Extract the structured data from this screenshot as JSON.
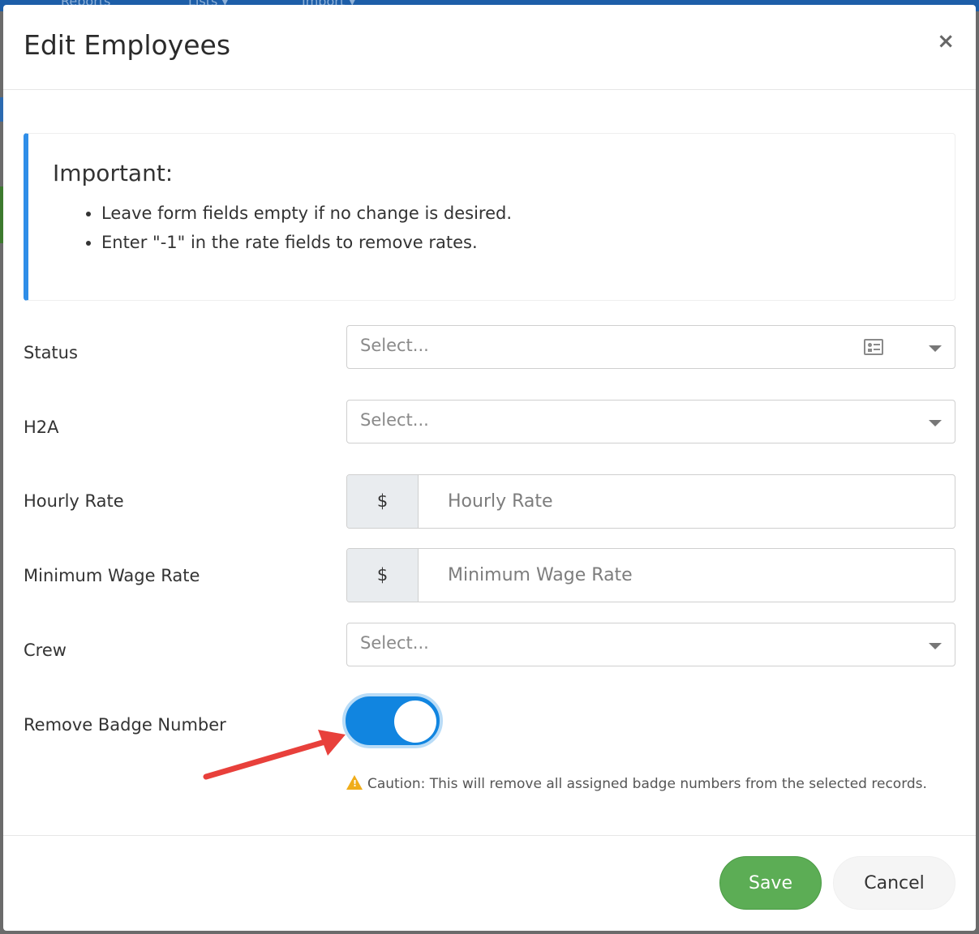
{
  "background": {
    "nav_items": [
      "Reports",
      "Lists ▾",
      "Import ▾"
    ]
  },
  "modal": {
    "title": "Edit Employees",
    "close_label": "×"
  },
  "callout": {
    "title": "Important:",
    "items": [
      "Leave form fields empty if no change is desired.",
      "Enter \"-1\" in the rate fields to remove rates."
    ]
  },
  "form": {
    "status": {
      "label": "Status",
      "placeholder": "Select...",
      "icon": "id-card-icon"
    },
    "h2a": {
      "label": "H2A",
      "placeholder": "Select..."
    },
    "hourly_rate": {
      "label": "Hourly Rate",
      "addon": "$",
      "placeholder": "Hourly Rate"
    },
    "min_wage_rate": {
      "label": "Minimum Wage Rate",
      "addon": "$",
      "placeholder": "Minimum Wage Rate"
    },
    "crew": {
      "label": "Crew",
      "placeholder": "Select..."
    },
    "remove_badge": {
      "label": "Remove Badge Number",
      "enabled": true
    },
    "caution": "Caution: This will remove all assigned badge numbers from the selected records."
  },
  "footer": {
    "save_label": "Save",
    "cancel_label": "Cancel"
  },
  "colors": {
    "primary": "#1185e0",
    "accent_border": "#2f8ee8",
    "save": "#5cad55",
    "warning": "#f0ad1a",
    "annotation_arrow": "#e8403b"
  }
}
